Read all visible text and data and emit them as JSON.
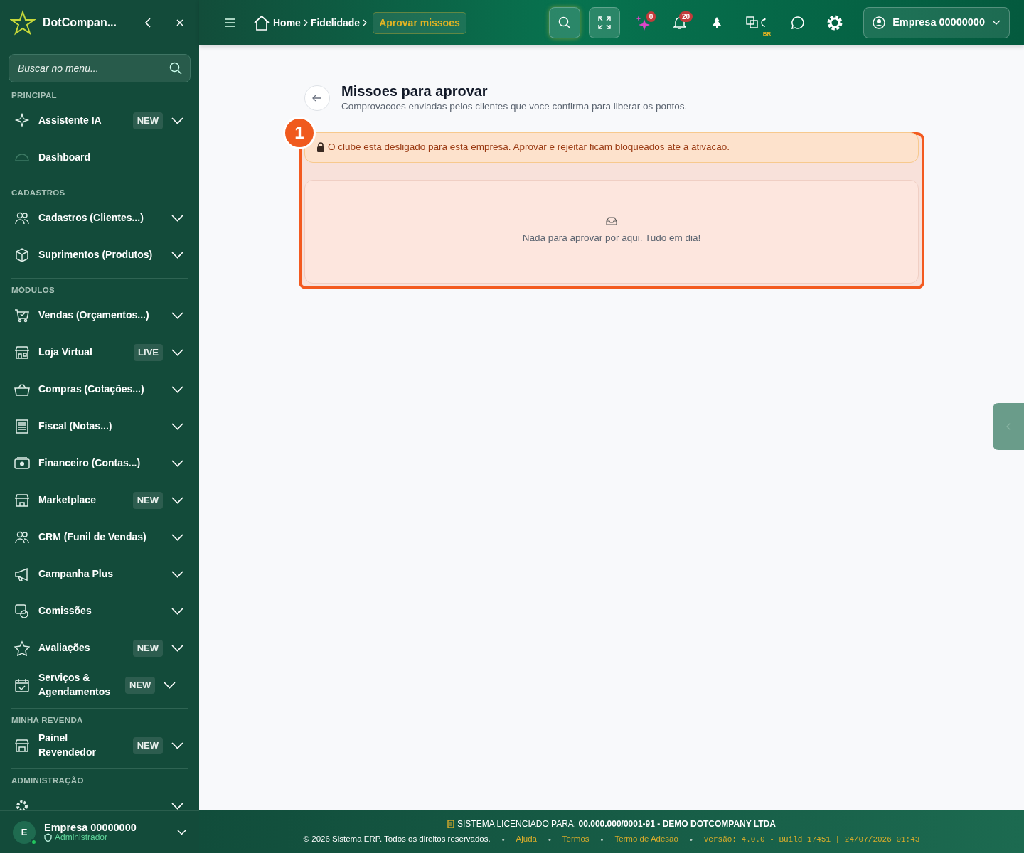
{
  "sidebar": {
    "brand": "DotCompan...",
    "search": {
      "placeholder": "Buscar no menu..."
    },
    "sections": [
      {
        "title": "PRINCIPAL",
        "items": [
          {
            "label": "Assistente IA",
            "badge": "NEW",
            "has_submenu": true
          },
          {
            "label": "Dashboard",
            "has_submenu": false
          }
        ]
      },
      {
        "title": "CADASTROS",
        "items": [
          {
            "label": "Cadastros (Clientes...)",
            "has_submenu": true
          },
          {
            "label": "Suprimentos (Produtos)",
            "has_submenu": true
          }
        ]
      },
      {
        "title": "MÓDULOS",
        "items": [
          {
            "label": "Vendas (Orçamentos...)",
            "has_submenu": true
          },
          {
            "label": "Loja Virtual",
            "badge": "LIVE",
            "has_submenu": true
          },
          {
            "label": "Compras (Cotações...)",
            "has_submenu": true
          },
          {
            "label": "Fiscal (Notas...)",
            "has_submenu": true
          },
          {
            "label": "Financeiro (Contas...)",
            "has_submenu": true
          },
          {
            "label": "Marketplace",
            "badge": "NEW",
            "has_submenu": true
          },
          {
            "label": "CRM (Funil de Vendas)",
            "has_submenu": true
          },
          {
            "label": "Campanha Plus",
            "has_submenu": true
          },
          {
            "label": "Comissões",
            "has_submenu": true
          },
          {
            "label": "Avaliações",
            "badge": "NEW",
            "has_submenu": true
          },
          {
            "label": "Serviços & Agendamentos",
            "badge": "NEW",
            "has_submenu": true
          }
        ]
      },
      {
        "title": "MINHA REVENDA",
        "items": [
          {
            "label": "Painel Revendedor",
            "badge": "NEW",
            "has_submenu": true
          }
        ]
      },
      {
        "title": "ADMINISTRAÇÃO",
        "items": [
          {
            "has_submenu": true
          }
        ]
      }
    ],
    "user": {
      "initial": "E",
      "name": "Empresa 00000000",
      "role": "Administrador",
      "online": true
    }
  },
  "topbar": {
    "breadcrumb": [
      {
        "label": "Home",
        "selected": false
      },
      {
        "label": "Fidelidade",
        "selected": false
      },
      {
        "label": "Aprovar missoes",
        "selected": true
      }
    ],
    "badges": {
      "ai": "0",
      "notifications": "20"
    },
    "language": "BR",
    "account": "Empresa 00000000"
  },
  "page": {
    "title": "Missoes para aprovar",
    "subtitle": "Comprovacoes enviadas pelos clientes que voce confirma para liberar os pontos.",
    "alert": "O clube esta desligado para esta empresa. Aprovar e rejeitar ficam bloqueados ate a ativacao.",
    "empty_message": "Nada para aprovar por aqui. Tudo em dia!",
    "annotation": "1"
  },
  "footer": {
    "license_label": "SISTEMA LICENCIADO PARA:",
    "license_value": "00.000.000/0001-91 - DEMO DOTCOMPANY LTDA",
    "copyright": "© 2026 Sistema ERP. Todos os direitos reservados.",
    "links": [
      "Ajuda",
      "Termos",
      "Termo de Adesao"
    ],
    "separators": [
      "•",
      "•",
      "•",
      "•"
    ],
    "version": "Versão: 4.0.0 - Build 17451 | 24/07/2026 01:43"
  }
}
